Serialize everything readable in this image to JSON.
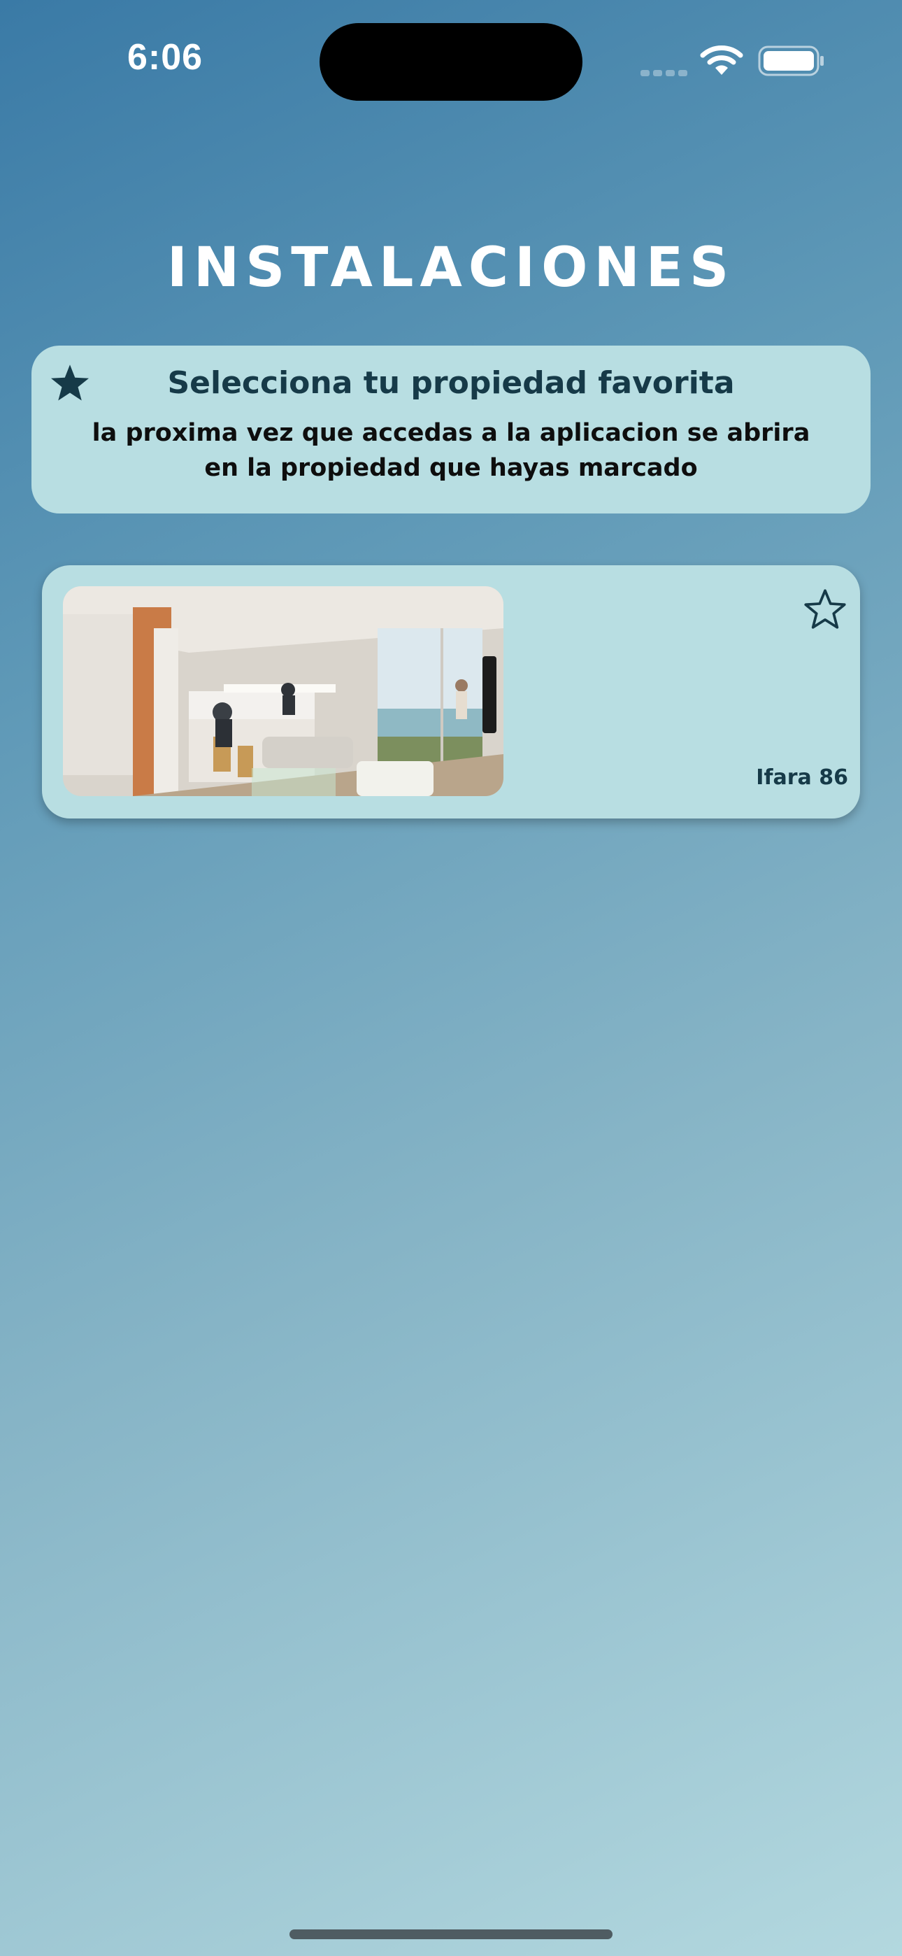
{
  "status_bar": {
    "time": "6:06",
    "signal_icon": "cellular-signal-icon",
    "wifi_icon": "wifi-icon",
    "battery_icon": "battery-icon"
  },
  "header": {
    "title": "INSTALACIONES"
  },
  "info_card": {
    "icon": "star-filled-icon",
    "heading": "Selecciona tu propiedad favorita",
    "body": "la proxima vez que accedas a la aplicacion se abrira en la propiedad que hayas marcado"
  },
  "properties": [
    {
      "name": "Ifara 86",
      "favorite_icon": "star-outline-icon",
      "is_favorite": false
    }
  ],
  "colors": {
    "accent": "#163a48",
    "card_background": "#b8dee2"
  }
}
